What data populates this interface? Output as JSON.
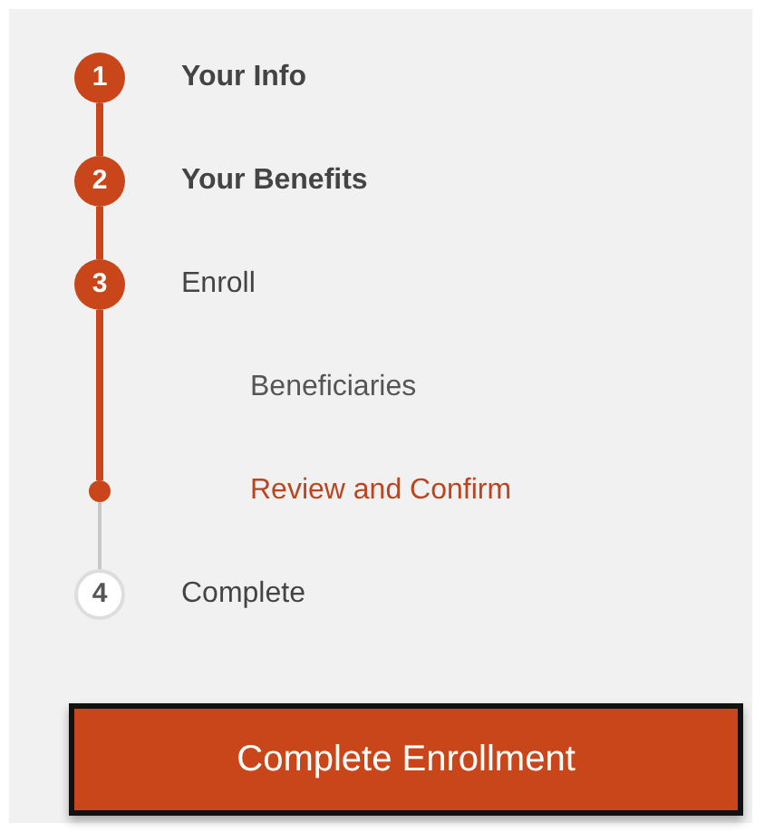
{
  "steps": [
    {
      "number": "1",
      "label": "Your Info",
      "completed": true,
      "active": false
    },
    {
      "number": "2",
      "label": "Your Benefits",
      "completed": true,
      "active": false
    },
    {
      "number": "3",
      "label": "Enroll",
      "completed": false,
      "active": true,
      "children": [
        {
          "label": "Beneficiaries",
          "selected": false
        },
        {
          "label": "Review and Confirm",
          "selected": true
        }
      ]
    },
    {
      "number": "4",
      "label": "Complete",
      "completed": false,
      "active": false
    }
  ],
  "button": {
    "label": "Complete Enrollment"
  }
}
